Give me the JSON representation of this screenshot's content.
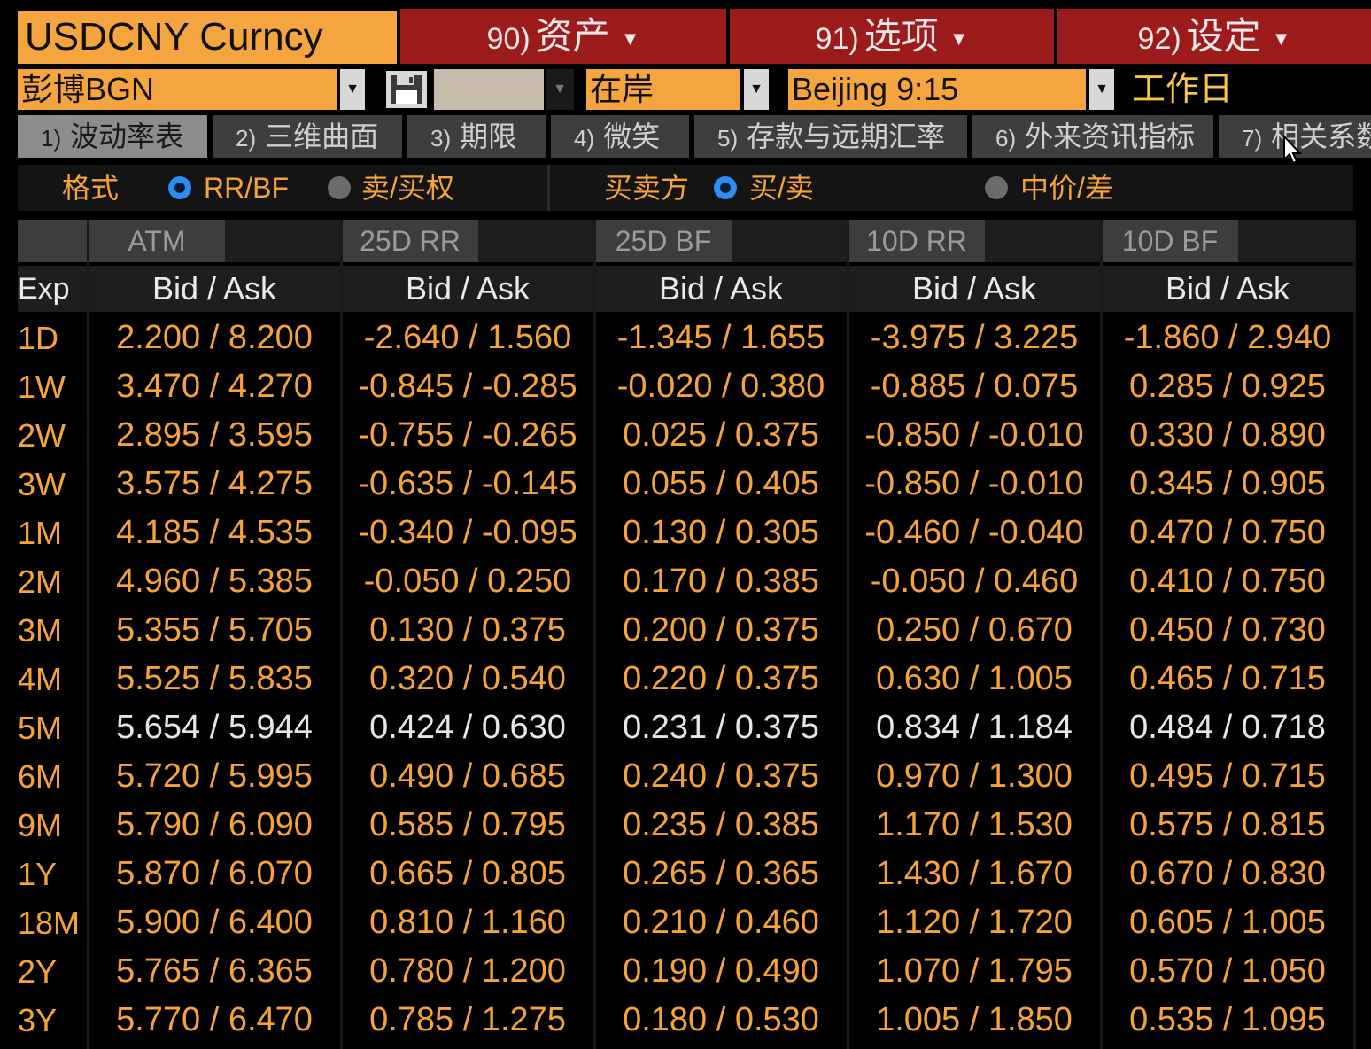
{
  "header": {
    "ticker": "USDCNY Curncy",
    "menus": [
      {
        "num": "90)",
        "label": "资产"
      },
      {
        "num": "91)",
        "label": "选项"
      },
      {
        "num": "92)",
        "label": "设定"
      }
    ]
  },
  "toolbar": {
    "source": "彭博BGN",
    "market": "在岸",
    "time": "Beijing 9:15",
    "day_type": "工作日"
  },
  "tabs": [
    {
      "num": "1)",
      "label": "波动率表"
    },
    {
      "num": "2)",
      "label": "三维曲面"
    },
    {
      "num": "3)",
      "label": "期限"
    },
    {
      "num": "4)",
      "label": "微笑"
    },
    {
      "num": "5)",
      "label": "存款与远期汇率"
    },
    {
      "num": "6)",
      "label": "外来资讯指标"
    },
    {
      "num": "7)",
      "label": "相关系数"
    }
  ],
  "options": {
    "format_label": "格式",
    "format_choices": [
      "RR/BF",
      "卖/买权"
    ],
    "side_label": "买卖方",
    "side_choices": [
      "买/卖",
      "中价/差"
    ]
  },
  "table": {
    "exp_header": "Exp",
    "groups": [
      "ATM",
      "25D RR",
      "25D BF",
      "10D RR",
      "10D BF"
    ],
    "sub_header": "Bid / Ask",
    "highlight_row": "5M",
    "rows": [
      {
        "exp": "1D",
        "cells": [
          "2.200 / 8.200",
          "-2.640 / 1.560",
          "-1.345 / 1.655",
          "-3.975 / 3.225",
          "-1.860 / 2.940"
        ]
      },
      {
        "exp": "1W",
        "cells": [
          "3.470 / 4.270",
          "-0.845 / -0.285",
          "-0.020 / 0.380",
          "-0.885 / 0.075",
          "0.285 / 0.925"
        ]
      },
      {
        "exp": "2W",
        "cells": [
          "2.895 / 3.595",
          "-0.755 / -0.265",
          "0.025 / 0.375",
          "-0.850 / -0.010",
          "0.330 / 0.890"
        ]
      },
      {
        "exp": "3W",
        "cells": [
          "3.575 / 4.275",
          "-0.635 / -0.145",
          "0.055 / 0.405",
          "-0.850 / -0.010",
          "0.345 / 0.905"
        ]
      },
      {
        "exp": "1M",
        "cells": [
          "4.185 / 4.535",
          "-0.340 / -0.095",
          "0.130 / 0.305",
          "-0.460 / -0.040",
          "0.470 / 0.750"
        ]
      },
      {
        "exp": "2M",
        "cells": [
          "4.960 / 5.385",
          "-0.050 / 0.250",
          "0.170 / 0.385",
          "-0.050 / 0.460",
          "0.410 / 0.750"
        ]
      },
      {
        "exp": "3M",
        "cells": [
          "5.355 / 5.705",
          "0.130 / 0.375",
          "0.200 / 0.375",
          "0.250 / 0.670",
          "0.450 / 0.730"
        ]
      },
      {
        "exp": "4M",
        "cells": [
          "5.525 / 5.835",
          "0.320 / 0.540",
          "0.220 / 0.375",
          "0.630 / 1.005",
          "0.465 / 0.715"
        ]
      },
      {
        "exp": "5M",
        "cells": [
          "5.654 / 5.944",
          "0.424 / 0.630",
          "0.231 / 0.375",
          "0.834 / 1.184",
          "0.484 / 0.718"
        ]
      },
      {
        "exp": "6M",
        "cells": [
          "5.720 / 5.995",
          "0.490 / 0.685",
          "0.240 / 0.375",
          "0.970 / 1.300",
          "0.495 / 0.715"
        ]
      },
      {
        "exp": "9M",
        "cells": [
          "5.790 / 6.090",
          "0.585 / 0.795",
          "0.235 / 0.385",
          "1.170 / 1.530",
          "0.575 / 0.815"
        ]
      },
      {
        "exp": "1Y",
        "cells": [
          "5.870 / 6.070",
          "0.665 / 0.805",
          "0.265 / 0.365",
          "1.430 / 1.670",
          "0.670 / 0.830"
        ]
      },
      {
        "exp": "18M",
        "cells": [
          "5.900 / 6.400",
          "0.810 / 1.160",
          "0.210 / 0.460",
          "1.120 / 1.720",
          "0.605 / 1.005"
        ]
      },
      {
        "exp": "2Y",
        "cells": [
          "5.765 / 6.365",
          "0.780 / 1.200",
          "0.190 / 0.490",
          "1.070 / 1.795",
          "0.570 / 1.050"
        ]
      },
      {
        "exp": "3Y",
        "cells": [
          "5.770 / 6.470",
          "0.785 / 1.275",
          "0.180 / 0.530",
          "1.005 / 1.850",
          "0.535 / 1.095"
        ]
      }
    ]
  }
}
